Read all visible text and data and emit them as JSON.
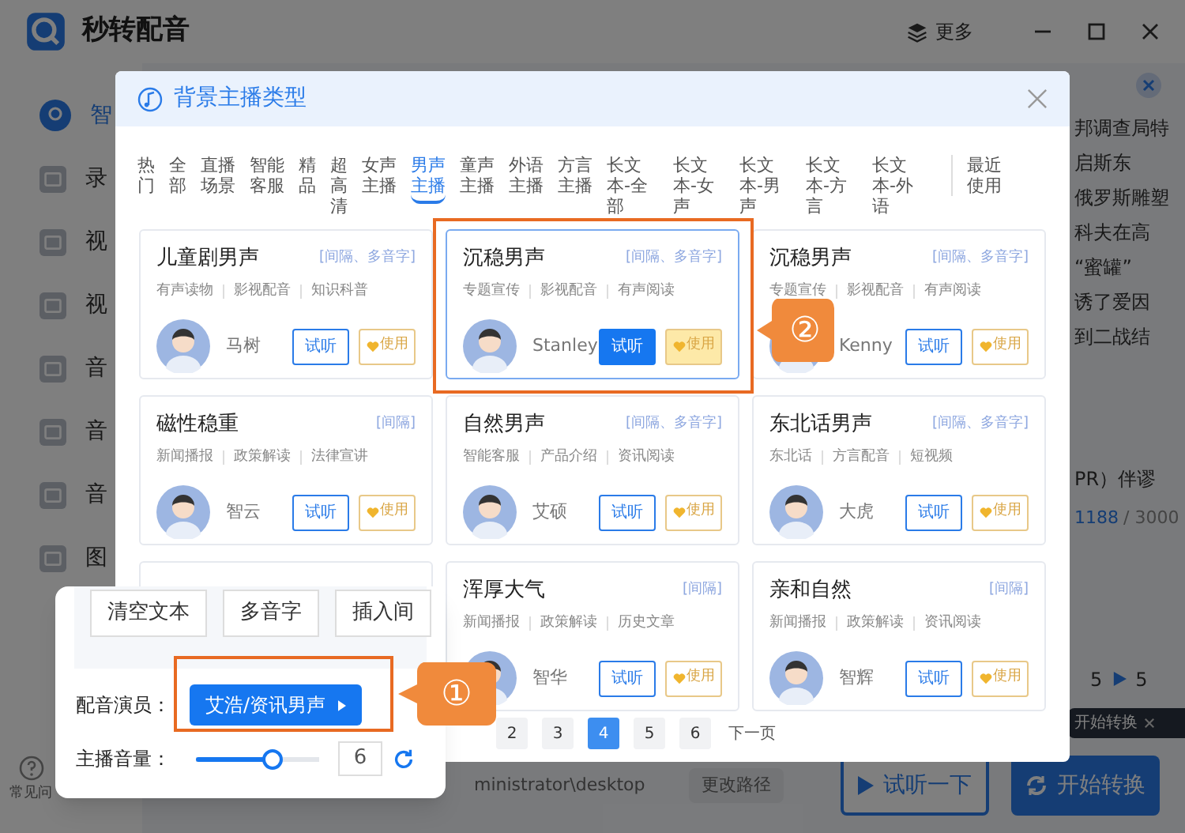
{
  "app": {
    "title": "秒转配音",
    "more": "更多",
    "sidebar": [
      {
        "label": "智",
        "selected": true
      },
      {
        "label": "录",
        "selected": false
      },
      {
        "label": "视",
        "selected": false
      },
      {
        "label": "视",
        "selected": false
      },
      {
        "label": "音",
        "selected": false
      },
      {
        "label": "音",
        "selected": false
      },
      {
        "label": "音",
        "selected": false
      },
      {
        "label": "图",
        "selected": false
      }
    ],
    "text_lines": [
      "邦调查局特",
      "启斯东",
      "俄罗斯雕塑",
      "科夫在高",
      "“蜜罐”",
      "诱了爱因",
      "到二战结"
    ],
    "text_tail": "PR）伴谬",
    "count": "1188",
    "limit": "/ 3000",
    "speed_from": "5",
    "speed_to": "5",
    "help": "常见问",
    "path": "ministrator\\desktop",
    "change_path": "更改路径",
    "preview_button": "试听一下",
    "convert_button": "开始转换",
    "tooltip": "开始转换"
  },
  "dialog": {
    "title": "背景主播类型",
    "tabs": [
      {
        "label": "热门",
        "selected": false
      },
      {
        "label": "全部",
        "selected": false
      },
      {
        "label": "直播场景",
        "selected": false
      },
      {
        "label": "智能客服",
        "selected": false
      },
      {
        "label": "精品",
        "selected": false
      },
      {
        "label": "超高清",
        "selected": false
      },
      {
        "label": "女声主播",
        "selected": false
      },
      {
        "label": "男声主播",
        "selected": true
      },
      {
        "label": "童声主播",
        "selected": false
      },
      {
        "label": "外语主播",
        "selected": false
      },
      {
        "label": "方言主播",
        "selected": false
      },
      {
        "label": "长文本-全部",
        "selected": false
      },
      {
        "label": "长文本-女声",
        "selected": false
      },
      {
        "label": "长文本-男声",
        "selected": false
      },
      {
        "label": "长文本-方言",
        "selected": false
      },
      {
        "label": "长文本-外语",
        "selected": false
      },
      {
        "label": "最近使用",
        "selected": false
      }
    ],
    "cards": [
      {
        "covered": false,
        "title": "儿童剧男声",
        "badge": "[间隔、多音字]",
        "tags": [
          "有声读物",
          "影视配音",
          "知识科普"
        ],
        "name": "马树",
        "listen": "试听",
        "use": "使用",
        "selected": false
      },
      {
        "covered": false,
        "title": "沉稳男声",
        "badge": "[间隔、多音字]",
        "tags": [
          "专题宣传",
          "影视配音",
          "有声阅读"
        ],
        "name": "Stanley",
        "listen": "试听",
        "use": "使用",
        "selected": true
      },
      {
        "covered": false,
        "title": "沉稳男声",
        "badge": "[间隔、多音字]",
        "tags": [
          "专题宣传",
          "影视配音",
          "有声阅读"
        ],
        "name": "Kenny",
        "listen": "试听",
        "use": "使用",
        "selected": false
      },
      {
        "covered": false,
        "title": "磁性稳重",
        "badge": "[间隔]",
        "tags": [
          "新闻播报",
          "政策解读",
          "法律宣讲"
        ],
        "name": "智云",
        "listen": "试听",
        "use": "使用",
        "selected": false
      },
      {
        "covered": false,
        "title": "自然男声",
        "badge": "[间隔、多音字]",
        "tags": [
          "智能客服",
          "产品介绍",
          "资讯阅读"
        ],
        "name": "艾硕",
        "listen": "试听",
        "use": "使用",
        "selected": false
      },
      {
        "covered": false,
        "title": "东北话男声",
        "badge": "[间隔、多音字]",
        "tags": [
          "东北话",
          "方言配音",
          "短视频"
        ],
        "name": "大虎",
        "listen": "试听",
        "use": "使用",
        "selected": false
      },
      {
        "covered": true
      },
      {
        "covered": false,
        "title": "浑厚大气",
        "badge": "[间隔]",
        "tags": [
          "新闻播报",
          "政策解读",
          "历史文章"
        ],
        "name": "智华",
        "listen": "试听",
        "use": "使用",
        "selected": false
      },
      {
        "covered": false,
        "title": "亲和自然",
        "badge": "[间隔]",
        "tags": [
          "新闻播报",
          "政策解读",
          "资讯阅读"
        ],
        "name": "智辉",
        "listen": "试听",
        "use": "使用",
        "selected": false
      }
    ],
    "pages": [
      {
        "label": "2",
        "selected": false
      },
      {
        "label": "3",
        "selected": false
      },
      {
        "label": "4",
        "selected": true
      },
      {
        "label": "5",
        "selected": false
      },
      {
        "label": "6",
        "selected": false
      }
    ],
    "next": "下一页"
  },
  "popup": {
    "tools": [
      "清空文本",
      "多音字",
      "插入间"
    ],
    "voice_label": "配音演员：",
    "voice_button": "艾浩/资讯男声",
    "volume_label": "主播音量：",
    "volume": {
      "level": 0.62,
      "value": "6"
    }
  },
  "callouts": [
    {
      "kind": "card",
      "number": "②"
    },
    {
      "kind": "voice",
      "number": "①"
    }
  ]
}
